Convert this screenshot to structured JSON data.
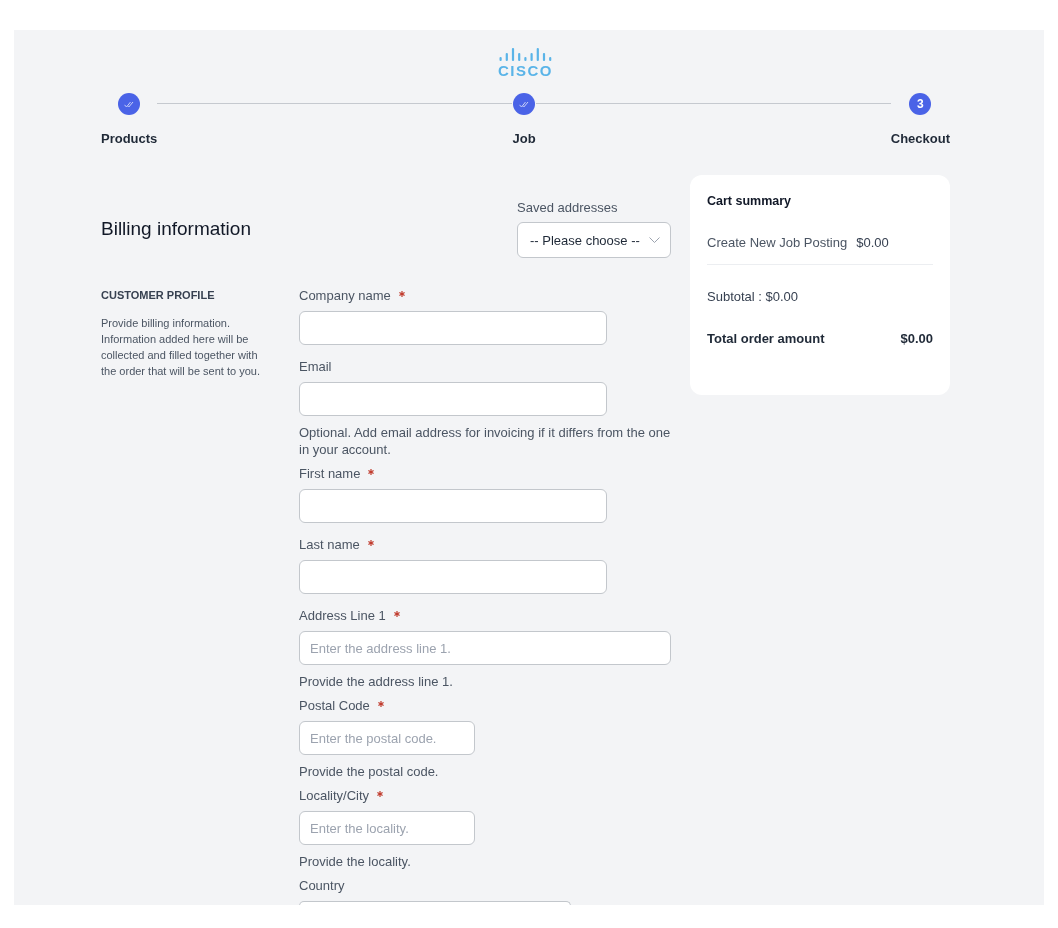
{
  "logo": {
    "text": "CISCO"
  },
  "steps": [
    {
      "label": "Products",
      "completed": true
    },
    {
      "label": "Job",
      "completed": true
    },
    {
      "label": "Checkout",
      "completed": false,
      "number": "3"
    }
  ],
  "billing": {
    "title": "Billing information",
    "saved_addresses": {
      "label": "Saved addresses",
      "value": "-- Please choose --"
    }
  },
  "profile": {
    "title": "CUSTOMER PROFILE",
    "description": "Provide billing information. Information added here will be collected and filled together with the order that will be sent to you."
  },
  "fields": [
    {
      "label": "Company name",
      "required": true
    },
    {
      "label": "Email",
      "required": false,
      "help": "Optional. Add email address for invoicing if it differs from the one in your account."
    },
    {
      "label": "First name",
      "required": true
    },
    {
      "label": "Last name",
      "required": true
    },
    {
      "label": "Address Line 1",
      "required": true,
      "placeholder": "Enter the address line 1.",
      "help": "Provide the address line 1."
    },
    {
      "label": "Postal Code",
      "required": true,
      "placeholder": "Enter the postal code.",
      "help": "Provide the postal code."
    },
    {
      "label": "Locality/City",
      "required": true,
      "placeholder": "Enter the locality.",
      "help": "Provide the locality."
    },
    {
      "label": "Country",
      "required": false
    }
  ],
  "cart": {
    "title": "Cart summary",
    "items": [
      {
        "name": "Create New Job Posting",
        "price": "$0.00"
      }
    ],
    "subtotal": "Subtotal : $0.00",
    "total_label": "Total order amount",
    "total": "$0.00"
  }
}
